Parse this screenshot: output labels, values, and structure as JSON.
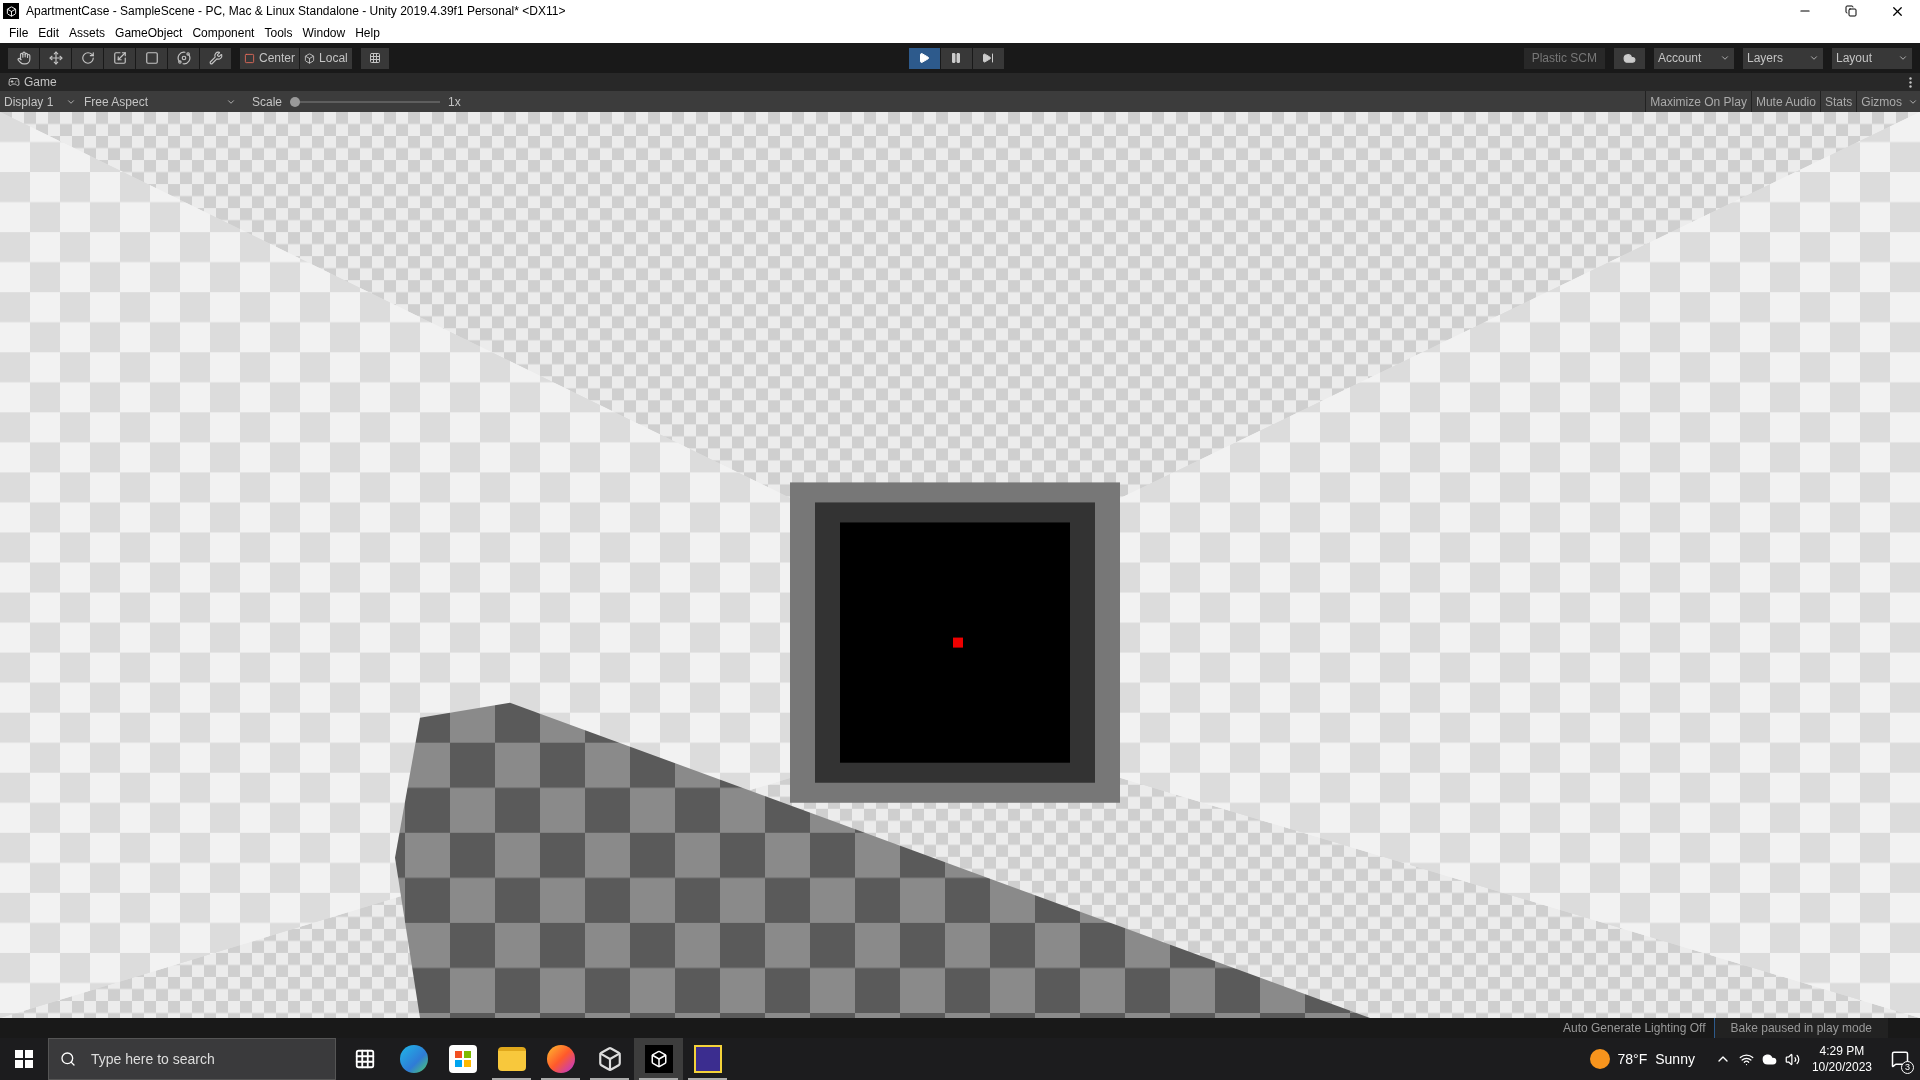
{
  "window": {
    "title": "ApartmentCase - SampleScene - PC, Mac & Linux Standalone - Unity 2019.4.39f1 Personal* <DX11>"
  },
  "menu": [
    "File",
    "Edit",
    "Assets",
    "GameObject",
    "Component",
    "Tools",
    "Window",
    "Help"
  ],
  "toolbar": {
    "pivot": "Center",
    "space": "Local",
    "play": {
      "selected": true
    },
    "plastic": "Plastic SCM",
    "dropdowns": [
      "Account",
      "Layers",
      "Layout"
    ]
  },
  "game_tab": {
    "label": "Game"
  },
  "game_bar": {
    "display": "Display 1",
    "aspect": "Free Aspect",
    "scale_label": "Scale",
    "scale": {
      "level": 0.0
    },
    "scale_value": "1x",
    "toggles": [
      "Maximize On Play",
      "Mute Audio",
      "Stats",
      "Gizmos"
    ]
  },
  "status_bar": {
    "lighting": "Auto Generate Lighting Off",
    "bake": "Bake paused in play mode"
  },
  "taskbar": {
    "search_placeholder": "Type here to search",
    "apps": [
      {
        "kind": "taskview",
        "running": false,
        "selected": false
      },
      {
        "kind": "edge",
        "running": false,
        "selected": false
      },
      {
        "kind": "store",
        "running": false,
        "selected": false
      },
      {
        "kind": "explorer",
        "running": true,
        "selected": false
      },
      {
        "kind": "firefox",
        "running": true,
        "selected": false
      },
      {
        "kind": "hub",
        "running": true,
        "selected": false
      },
      {
        "kind": "unity",
        "running": true,
        "selected": true
      },
      {
        "kind": "game",
        "running": true,
        "selected": false
      }
    ],
    "weather": {
      "temp": "78°F",
      "condition": "Sunny"
    },
    "time": "4:29 PM",
    "date": "10/20/2023",
    "notifications": "3"
  }
}
